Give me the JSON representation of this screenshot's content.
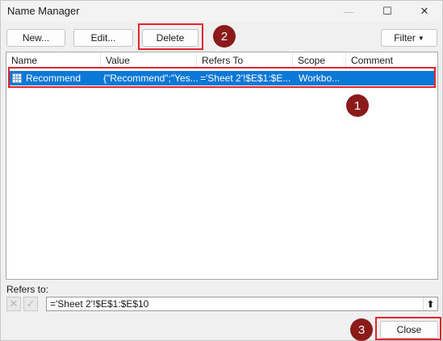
{
  "window": {
    "title": "Name Manager",
    "minimize_icon": "—",
    "maximize_icon": "☐",
    "close_icon": "✕"
  },
  "toolbar": {
    "new_label": "New...",
    "edit_label": "Edit...",
    "delete_label": "Delete",
    "filter_label": "Filter"
  },
  "table": {
    "columns": [
      "Name",
      "Value",
      "Refers To",
      "Scope",
      "Comment"
    ],
    "rows": [
      {
        "name": "Recommend",
        "value": "{\"Recommend\";\"Yes...",
        "refers_to": "='Sheet 2'!$E$1:$E...",
        "scope": "Workbo...",
        "comment": ""
      }
    ]
  },
  "refers_to": {
    "label": "Refers to:",
    "value": "='Sheet 2'!$E$1:$E$10"
  },
  "footer": {
    "close_label": "Close"
  },
  "annotations": {
    "markers": [
      "1",
      "2",
      "3"
    ],
    "highlight_color": "#e0262b",
    "marker_color": "#8b1a1a"
  },
  "colors": {
    "selection": "#0b78d7"
  }
}
